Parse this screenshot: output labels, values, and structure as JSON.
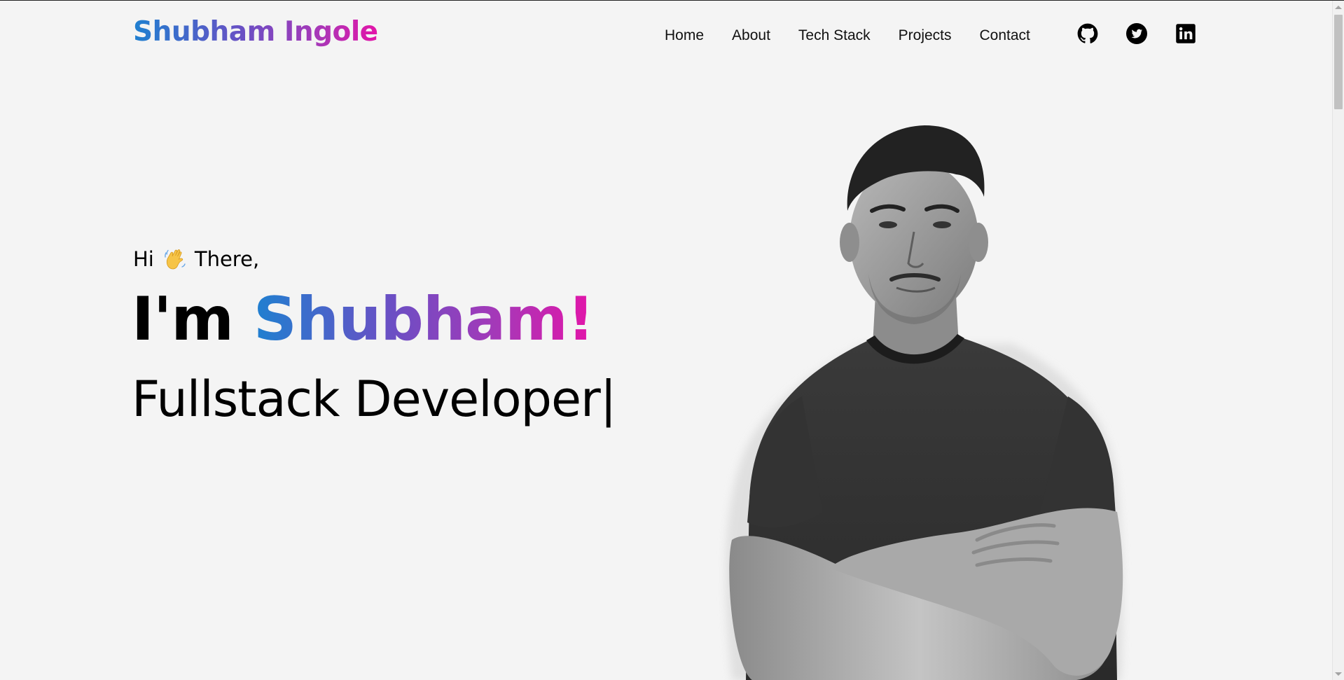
{
  "header": {
    "logo": "Shubham Ingole",
    "nav": [
      "Home",
      "About",
      "Tech Stack",
      "Projects",
      "Contact"
    ],
    "social_icons": [
      "github-icon",
      "twitter-icon",
      "linkedin-icon"
    ]
  },
  "hero": {
    "greeting_hi": "Hi",
    "greeting_emoji": "waving-hand-icon",
    "greeting_there": "There,",
    "headline_prefix": "I'm",
    "headline_name": "Shubham!",
    "role": "Fullstack Developer",
    "cursor": "|"
  },
  "colors": {
    "background": "#f4f4f4",
    "gradient_start": "#1f80d0",
    "gradient_mid": "#6a4fc4",
    "gradient_end": "#e414a8",
    "text": "#000000"
  }
}
